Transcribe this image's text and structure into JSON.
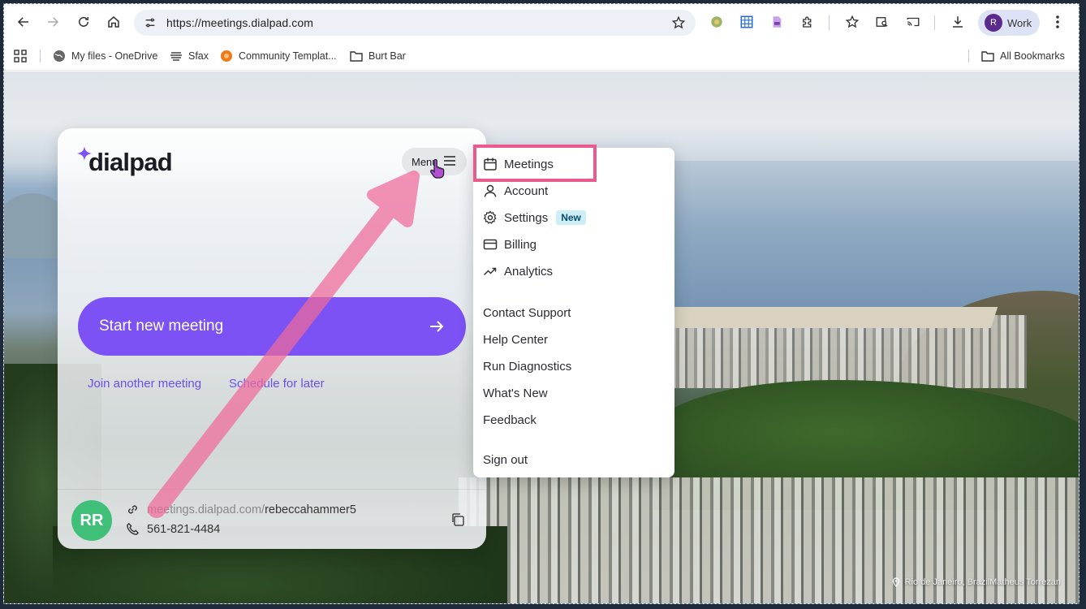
{
  "browser": {
    "url": "https://meetings.dialpad.com",
    "profile_initial": "R",
    "profile_label": "Work"
  },
  "bookmarks": {
    "items": [
      {
        "label": "My files - OneDrive"
      },
      {
        "label": "Sfax"
      },
      {
        "label": "Community Templat..."
      },
      {
        "label": "Burt Bar"
      }
    ],
    "all_bookmarks": "All Bookmarks"
  },
  "card": {
    "logo_text": "dialpad",
    "menu_label": "Menu",
    "start_button": "Start new meeting",
    "join_link": "Join another meeting",
    "schedule_link": "Schedule for later",
    "avatar_initials": "RR",
    "meeting_url_domain": "meetings.dialpad.com/",
    "meeting_url_user": "rebeccahammer5",
    "phone": "561-821-4484"
  },
  "menu": {
    "primary": [
      {
        "label": "Meetings",
        "icon": "calendar-icon"
      },
      {
        "label": "Account",
        "icon": "person-icon"
      },
      {
        "label": "Settings",
        "icon": "gear-icon",
        "badge": "New"
      },
      {
        "label": "Billing",
        "icon": "card-icon"
      },
      {
        "label": "Analytics",
        "icon": "trend-icon"
      }
    ],
    "secondary": [
      {
        "label": "Contact Support"
      },
      {
        "label": "Help Center"
      },
      {
        "label": "Run Diagnostics"
      },
      {
        "label": "What's New"
      },
      {
        "label": "Feedback"
      }
    ],
    "sign_out": "Sign out"
  },
  "photo_credit": "Rio de Janeiro, BrazilMatheus Torrezan",
  "colors": {
    "accent": "#7c52f4",
    "link": "#6a4ff0",
    "avatar": "#3fbf78",
    "highlight": "#ea5a8c"
  }
}
